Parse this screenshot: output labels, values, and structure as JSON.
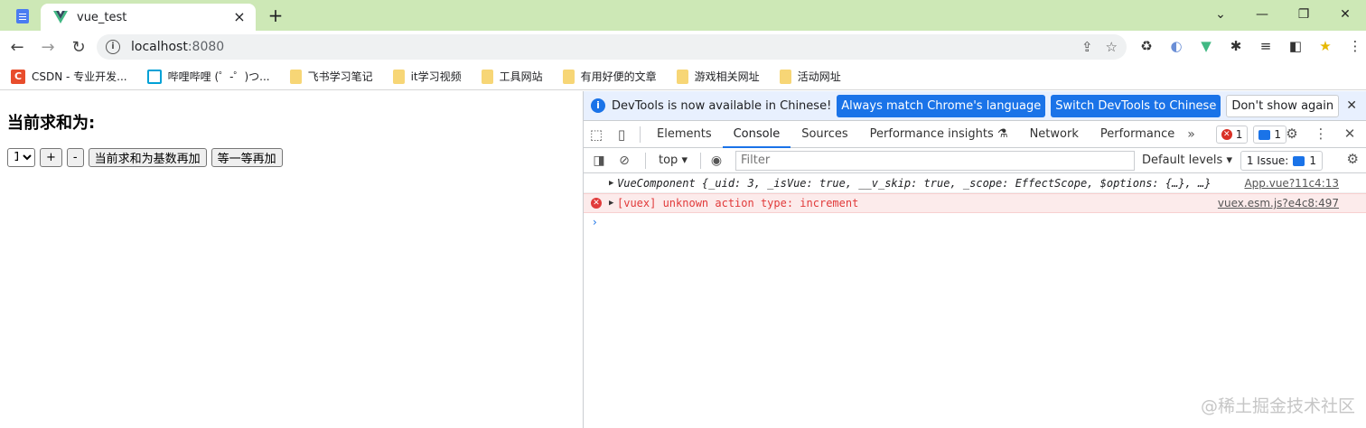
{
  "browser": {
    "tab_title": "vue_test",
    "url_host": "localhost",
    "url_port": ":8080",
    "bookmarks": [
      {
        "label": "CSDN - 专业开发...",
        "icon": "csdn-icon"
      },
      {
        "label": "哔哩哔哩 (゜-゜)つ...",
        "icon": "bilibili-icon"
      },
      {
        "label": "飞书学习笔记",
        "icon": "folder-icon"
      },
      {
        "label": "it学习视频",
        "icon": "folder-icon"
      },
      {
        "label": "工具网站",
        "icon": "folder-icon"
      },
      {
        "label": "有用好便的文章",
        "icon": "folder-icon"
      },
      {
        "label": "游戏相关网址",
        "icon": "folder-icon"
      },
      {
        "label": "活动网址",
        "icon": "folder-icon"
      }
    ]
  },
  "app": {
    "heading": "当前求和为:",
    "select_value": "1",
    "plus_label": "+",
    "minus_label": "-",
    "odd_add_label": "当前求和为基数再加",
    "wait_add_label": "等一等再加"
  },
  "devtools": {
    "banner_message": "DevTools is now available in Chinese!",
    "btn_match": "Always match Chrome's language",
    "btn_switch": "Switch DevTools to Chinese",
    "btn_dismiss": "Don't show again",
    "tabs": [
      "Elements",
      "Console",
      "Sources",
      "Performance insights",
      "Network",
      "Performance"
    ],
    "active_tab": "Console",
    "error_count": "1",
    "message_count": "1",
    "context": "top",
    "filter_placeholder": "Filter",
    "levels": "Default levels",
    "issues_label": "1 Issue:",
    "issues_count": "1",
    "logs": [
      {
        "text": "VueComponent {_uid: 3, _isVue: true, __v_skip: true, _scope: EffectScope, $options: {…}, …}",
        "source": "App.vue?11c4:13",
        "level": "info"
      },
      {
        "text": "[vuex] unknown action type: increment",
        "source": "vuex.esm.js?e4c8:497",
        "level": "error"
      }
    ],
    "prompt": "›"
  },
  "watermark": "@稀土掘金技术社区"
}
